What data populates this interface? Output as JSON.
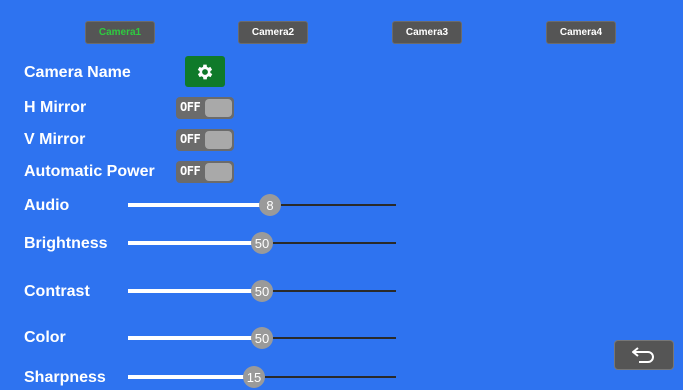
{
  "tabs": [
    {
      "label": "Camera1",
      "active": true
    },
    {
      "label": "Camera2",
      "active": false
    },
    {
      "label": "Camera3",
      "active": false
    },
    {
      "label": "Camera4",
      "active": false
    }
  ],
  "camera_name": {
    "label": "Camera Name",
    "icon": "gear-icon"
  },
  "toggles": [
    {
      "label": "H Mirror",
      "state": "OFF"
    },
    {
      "label": "V Mirror",
      "state": "OFF"
    },
    {
      "label": "Automatic Power",
      "state": "OFF"
    }
  ],
  "sliders": [
    {
      "label": "Audio",
      "value": "8",
      "fraction": 0.53
    },
    {
      "label": "Brightness",
      "value": "50",
      "fraction": 0.5
    },
    {
      "label": "Contrast",
      "value": "50",
      "fraction": 0.5
    },
    {
      "label": "Color",
      "value": "50",
      "fraction": 0.5
    },
    {
      "label": "Sharpness",
      "value": "15",
      "fraction": 0.47
    }
  ],
  "back_button": {
    "icon": "back-arrow-icon"
  },
  "colors": {
    "background": "#2e73f0",
    "active_tab_text": "#2ecc40",
    "gear_button": "#0f7a2a"
  }
}
